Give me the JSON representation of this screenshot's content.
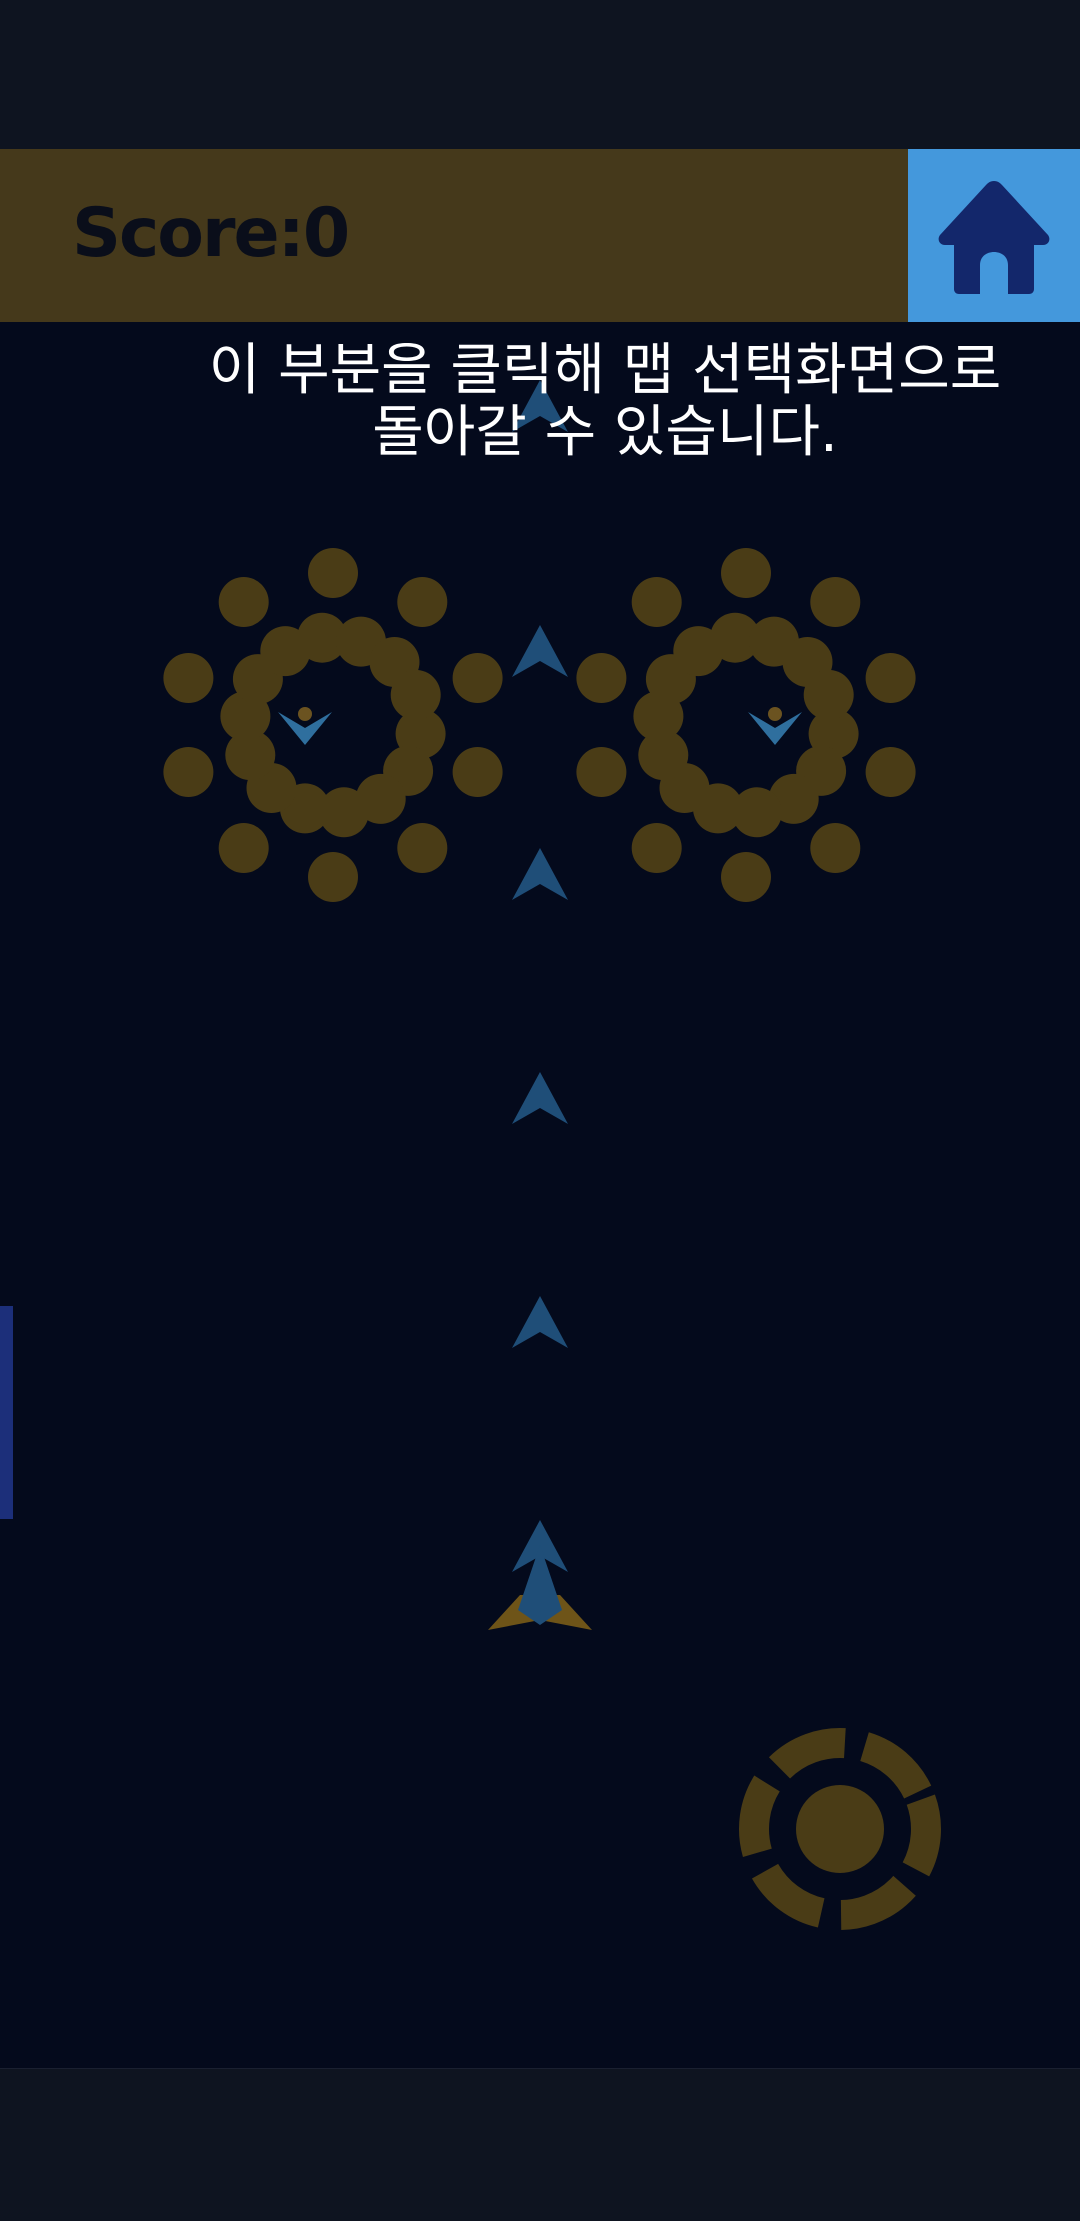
{
  "hud": {
    "score_label": "Score:",
    "score_value": 0
  },
  "home_button": {
    "icon": "home-icon"
  },
  "hint": {
    "text": "이 부분을 클릭해 맵 선택화면으로\n돌아갈 수 있습니다."
  },
  "colors": {
    "hud_bar": "#45391b",
    "home_button": "#4498dc",
    "home_icon": "#13276b",
    "orb": "#4a3c16",
    "enemy_ship": "#2f6f9e",
    "bullet": "#1f4e78",
    "player_ship": "#6e5418",
    "fire_button": "#4a3c16",
    "side_indicator": "#1c2f7a"
  },
  "game": {
    "enemies": 2,
    "player_bullets": 7,
    "fire_button_icon": "crosshair-icon"
  }
}
